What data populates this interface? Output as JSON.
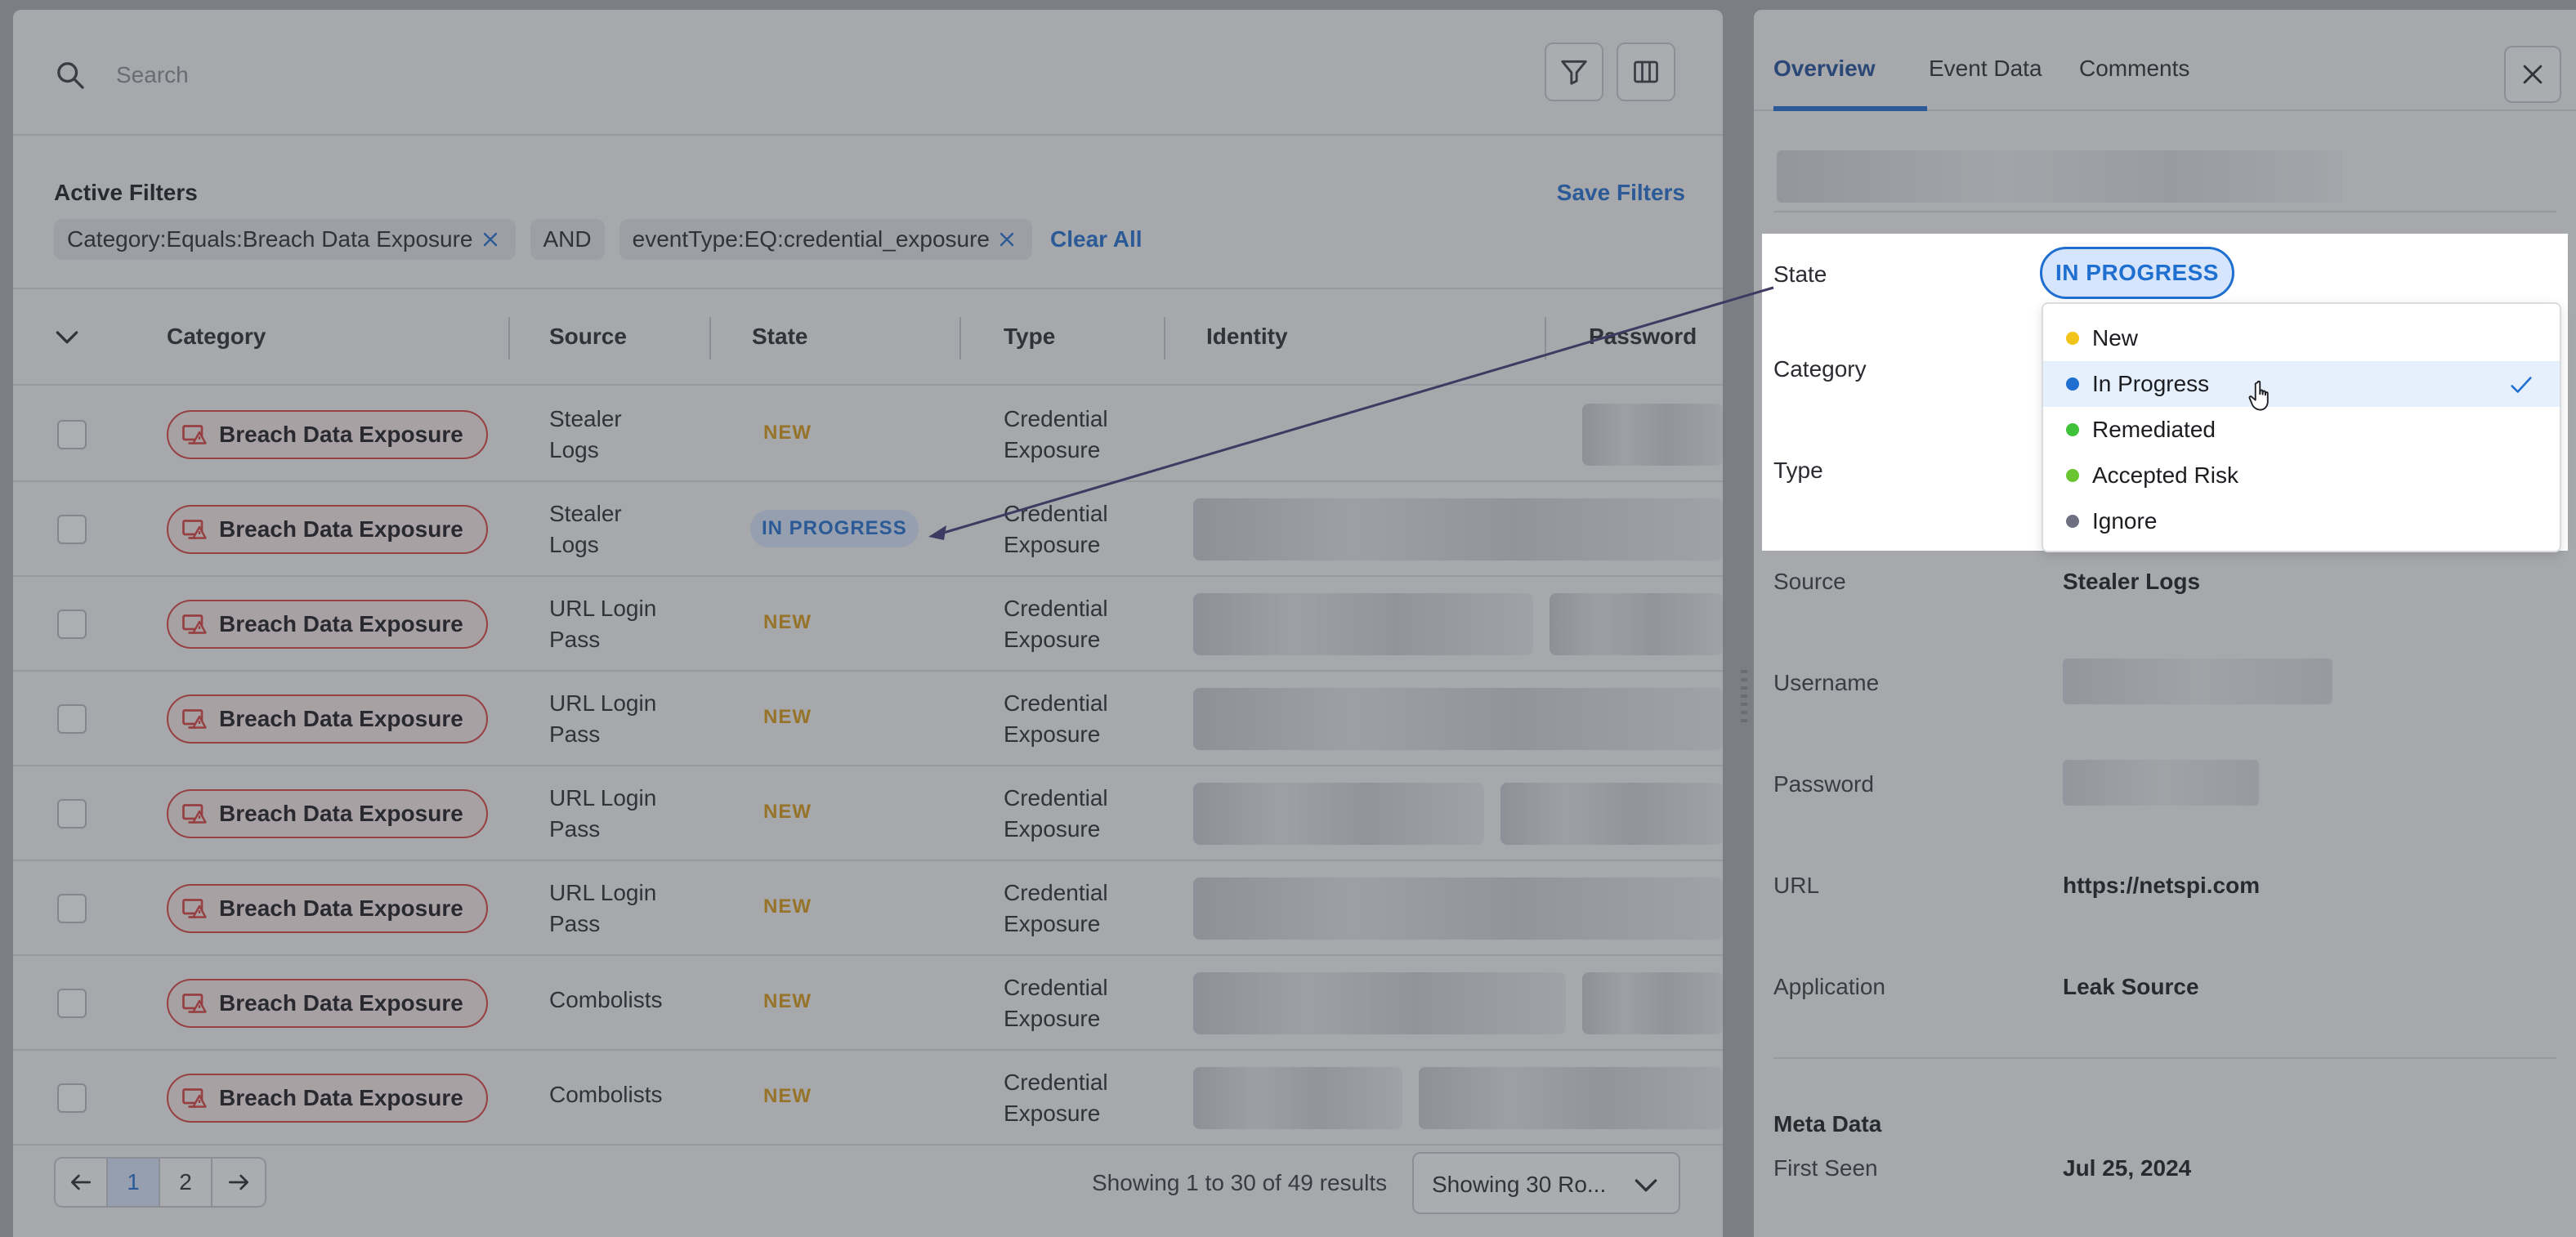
{
  "search": {
    "placeholder": "Search"
  },
  "filters": {
    "title": "Active Filters",
    "save_label": "Save Filters",
    "chips": [
      {
        "label": "Category:Equals:Breach Data Exposure"
      },
      {
        "label": "AND"
      },
      {
        "label": "eventType:EQ:credential_exposure"
      }
    ],
    "clear_label": "Clear All"
  },
  "table": {
    "columns": [
      "Category",
      "Source",
      "State",
      "Type",
      "Identity",
      "Password"
    ],
    "rows": [
      {
        "category": "Breach Data Exposure",
        "source": [
          "Stealer",
          "Logs"
        ],
        "state": "NEW",
        "type": [
          "Credential",
          "Exposure"
        ]
      },
      {
        "category": "Breach Data Exposure",
        "source": [
          "Stealer",
          "Logs"
        ],
        "state": "IN PROGRESS",
        "type": [
          "Credential",
          "Exposure"
        ]
      },
      {
        "category": "Breach Data Exposure",
        "source": [
          "URL Login",
          "Pass"
        ],
        "state": "NEW",
        "type": [
          "Credential",
          "Exposure"
        ]
      },
      {
        "category": "Breach Data Exposure",
        "source": [
          "URL Login",
          "Pass"
        ],
        "state": "NEW",
        "type": [
          "Credential",
          "Exposure"
        ]
      },
      {
        "category": "Breach Data Exposure",
        "source": [
          "URL Login",
          "Pass"
        ],
        "state": "NEW",
        "type": [
          "Credential",
          "Exposure"
        ]
      },
      {
        "category": "Breach Data Exposure",
        "source": [
          "URL Login",
          "Pass"
        ],
        "state": "NEW",
        "type": [
          "Credential",
          "Exposure"
        ]
      },
      {
        "category": "Breach Data Exposure",
        "source": [
          "Combolists"
        ],
        "state": "NEW",
        "type": [
          "Credential",
          "Exposure"
        ]
      },
      {
        "category": "Breach Data Exposure",
        "source": [
          "Combolists"
        ],
        "state": "NEW",
        "type": [
          "Credential",
          "Exposure"
        ]
      }
    ]
  },
  "pagination": {
    "pages": [
      "1",
      "2"
    ],
    "current": "1",
    "results_text": "Showing 1 to 30 of 49 results",
    "rows_select": "Showing 30 Ro..."
  },
  "detail": {
    "tabs": [
      "Overview",
      "Event Data",
      "Comments"
    ],
    "active_tab": "Overview",
    "fields": {
      "state_label": "State",
      "state_value": "IN PROGRESS",
      "category_label": "Category",
      "type_label": "Type",
      "source_label": "Source",
      "source_value": "Stealer Logs",
      "username_label": "Username",
      "password_label": "Password",
      "url_label": "URL",
      "url_value": "https://netspi.com",
      "application_label": "Application",
      "application_value": "Leak Source"
    },
    "meta": {
      "title": "Meta Data",
      "first_seen_label": "First Seen",
      "first_seen_value": "Jul 25, 2024"
    },
    "state_options": [
      {
        "label": "New",
        "color": "#f2c318"
      },
      {
        "label": "In Progress",
        "color": "#1f6fd1",
        "selected": true
      },
      {
        "label": "Remediated",
        "color": "#3fc23a"
      },
      {
        "label": "Accepted Risk",
        "color": "#6ac530"
      },
      {
        "label": "Ignore",
        "color": "#6e6f80"
      }
    ]
  },
  "colors": {
    "accent": "#1f6fd1",
    "new_state": "#d89a13",
    "category_border": "#d8433f"
  }
}
